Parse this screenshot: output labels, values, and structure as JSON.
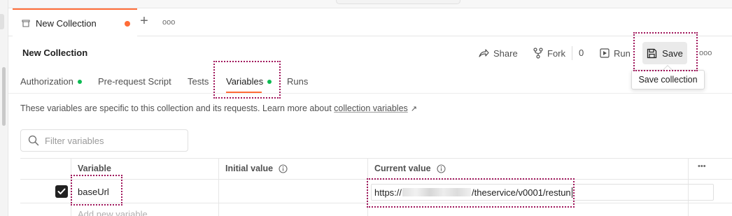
{
  "tabbar": {
    "tab_label": "New Collection",
    "plus_glyph": "+",
    "more_glyph": "ooo"
  },
  "header": {
    "title": "New Collection",
    "share_label": "Share",
    "fork_label": "Fork",
    "fork_count": "0",
    "run_label": "Run",
    "save_label": "Save",
    "more_glyph": "ooo",
    "save_tooltip": "Save collection"
  },
  "subtabs": [
    {
      "label": "Authorization",
      "dot": true
    },
    {
      "label": "Pre-request Script",
      "dot": false
    },
    {
      "label": "Tests",
      "dot": false
    },
    {
      "label": "Variables",
      "dot": true,
      "active": true
    },
    {
      "label": "Runs",
      "dot": false
    }
  ],
  "variables": {
    "description": "These variables are specific to this collection and its requests. Learn more about ",
    "description_link": "collection variables",
    "link_arrow": "↗",
    "filter_placeholder": "Filter variables",
    "columns": {
      "variable": "Variable",
      "initial": "Initial value",
      "current": "Current value"
    },
    "rows": [
      {
        "checked": true,
        "variable": "baseUrl",
        "initial_value": "",
        "current_value_prefix": "https://",
        "current_value_suffix": "/theservice/v0001/restun"
      }
    ],
    "add_placeholder": "Add new variable",
    "table_more_glyph": "•••"
  },
  "colors": {
    "accent": "#ff6c37",
    "status_dot": "#0cbb52",
    "highlight": "#a0165b"
  }
}
